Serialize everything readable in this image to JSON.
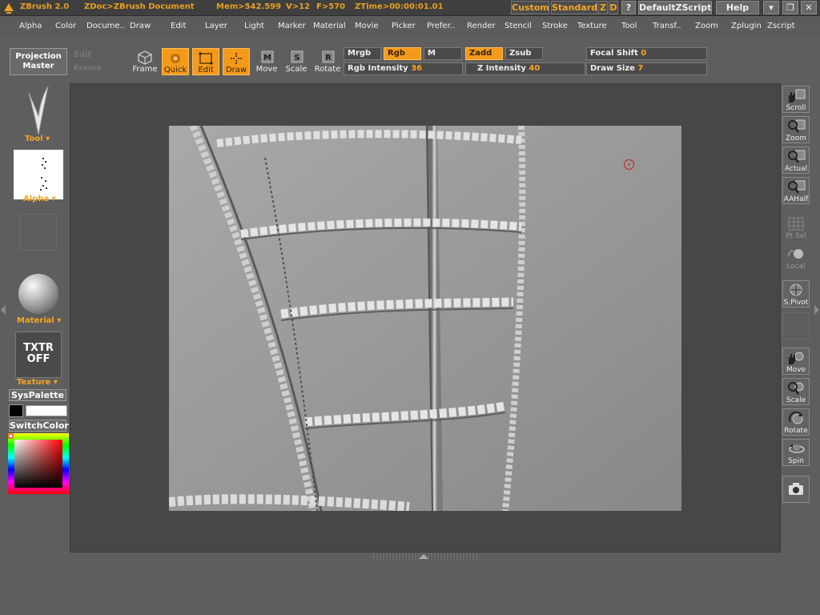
{
  "app": {
    "name": "ZBrush 2.0",
    "document": "ZDoc>ZBrush Document",
    "mem": "Mem>542.599",
    "vcount": "V>12",
    "fcount": "F>570",
    "ztime": "ZTime>00:00:01.01"
  },
  "titlebar": {
    "custom": "Custom",
    "standard": "Standard",
    "z": "Z",
    "d": "D",
    "q": "?",
    "script": "DefaultZScript",
    "help": "Help"
  },
  "menu": [
    "Alpha",
    "Color",
    "Docume..",
    "Draw",
    "Edit",
    "Layer",
    "Light",
    "Marker",
    "Material",
    "Movie",
    "Picker",
    "Prefer..",
    "Render",
    "Stencil",
    "Stroke",
    "Texture",
    "Tool",
    "Transf..",
    "Zoom",
    "Zplugin",
    "Zscript"
  ],
  "toolbar": {
    "projection_master": [
      "Projection",
      "Master"
    ],
    "ghost1": "Edit",
    "ghost2": "Frame",
    "tools": [
      "Frame",
      "Quick",
      "Edit",
      "Draw",
      "Move",
      "Scale",
      "Rotate"
    ],
    "rgb_row": {
      "mrgb": "Mrgb",
      "rgb": "Rgb",
      "m": "M",
      "zadd": "Zadd",
      "zsub": "Zsub",
      "focal_label": "Focal Shift",
      "focal_value": "0"
    },
    "int_row": {
      "rgb_int_label": "Rgb Intensity",
      "rgb_int_value": "36",
      "z_int_label": "Z Intensity",
      "z_int_value": "40",
      "draw_size_label": "Draw Size",
      "draw_size_value": "7"
    }
  },
  "left": {
    "tool": "Tool",
    "alpha": "Alpha",
    "material": "Material",
    "texture": "Texture",
    "txtr": [
      "TXTR",
      "OFF"
    ],
    "syspalette": "SysPalette",
    "switchcolor": "SwitchColor"
  },
  "right": [
    "Scroll",
    "Zoom",
    "Actual",
    "AAHalf",
    "Pt Sel",
    "Local",
    "S.Pivot",
    "Move",
    "Scale",
    "Rotate",
    "Spin"
  ],
  "colors": {
    "accent": "#f49a1b",
    "panel": "#5e5e5e",
    "canvas": "#474747"
  }
}
